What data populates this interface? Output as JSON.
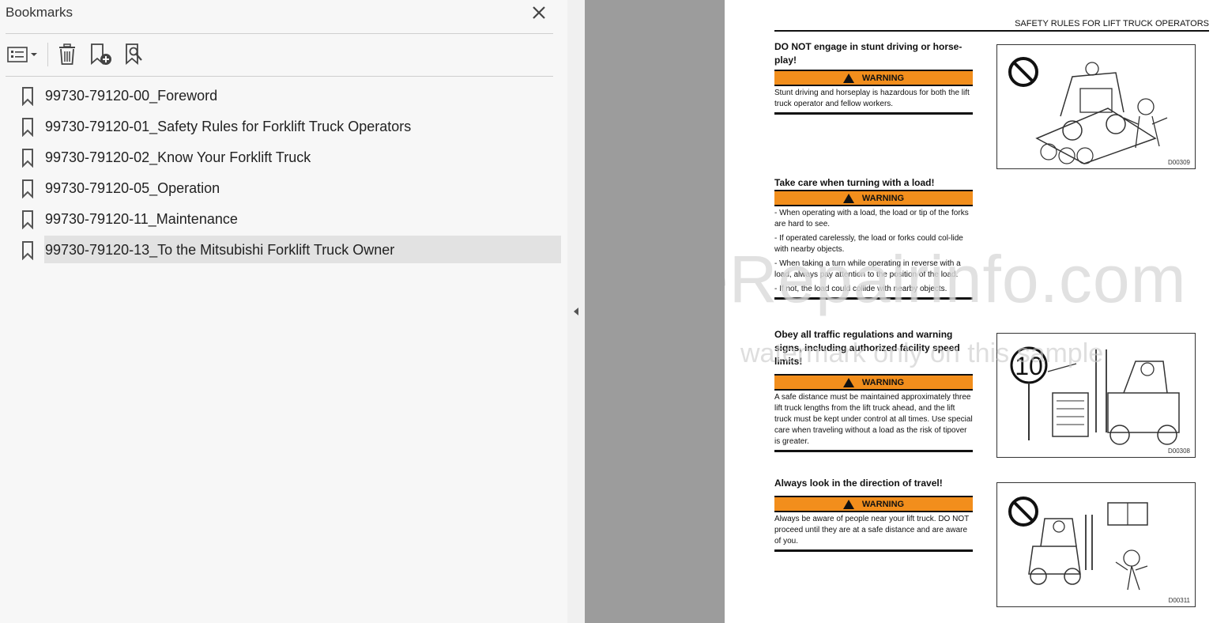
{
  "bookmarks_panel": {
    "title": "Bookmarks",
    "items": [
      {
        "label": "99730-79120-00_Foreword",
        "selected": false
      },
      {
        "label": "99730-79120-01_Safety Rules for Forklift Truck Operators",
        "selected": false
      },
      {
        "label": "99730-79120-02_Know Your Forklift Truck",
        "selected": false
      },
      {
        "label": "99730-79120-05_Operation",
        "selected": false
      },
      {
        "label": "99730-79120-11_Maintenance",
        "selected": false
      },
      {
        "label": "99730-79120-13_To the Mitsubishi Forklift Truck Owner",
        "selected": true
      }
    ],
    "toolbar_icons": [
      "options-list-icon",
      "chevron-down-icon",
      "trash-icon",
      "add-bookmark-icon",
      "find-bookmark-icon"
    ]
  },
  "document": {
    "header": "SAFETY RULES FOR LIFT TRUCK OPERATORS",
    "warning_label": "WARNING",
    "sections": [
      {
        "title": "DO NOT engage in stunt driving or horse-play!",
        "body": [
          "Stunt driving and horseplay is hazardous for both the lift truck operator and fellow workers."
        ],
        "figure_code": "D00309"
      },
      {
        "title": "Take care when turning with a load!",
        "body": [
          "- When operating with a load, the load or tip of the forks are hard to see.",
          "- If operated carelessly, the load or forks could col-lide with nearby objects.",
          "- When taking a turn while operating in reverse with a load, always pay attention to the position of the load.",
          "- If not, the load could collide with nearby objects."
        ]
      },
      {
        "title": "Obey all traffic regulations and warning signs, including authorized facility speed limits!",
        "body": [
          "A safe distance must be maintained approximately three lift truck lengths from the lift truck ahead, and the lift truck must be kept under control at all times. Use special care when traveling without a load as the risk of tipover is greater."
        ],
        "figure_code": "D00308",
        "sign_text": "10"
      },
      {
        "title": "Always look in the direction of travel!",
        "body": [
          "Always be aware of people near your lift truck. DO NOT proceed until they are at a safe distance and are aware of you."
        ],
        "figure_code": "D00311"
      }
    ],
    "watermark": {
      "line1": "eRepairinfo.com",
      "line2": "watermark only on this sample"
    }
  },
  "colors": {
    "warning_orange": "#f28e1c",
    "panel_bg": "#f7f7f7",
    "selected_bg": "#e2e2e2",
    "viewer_gray": "#9c9c9c"
  }
}
